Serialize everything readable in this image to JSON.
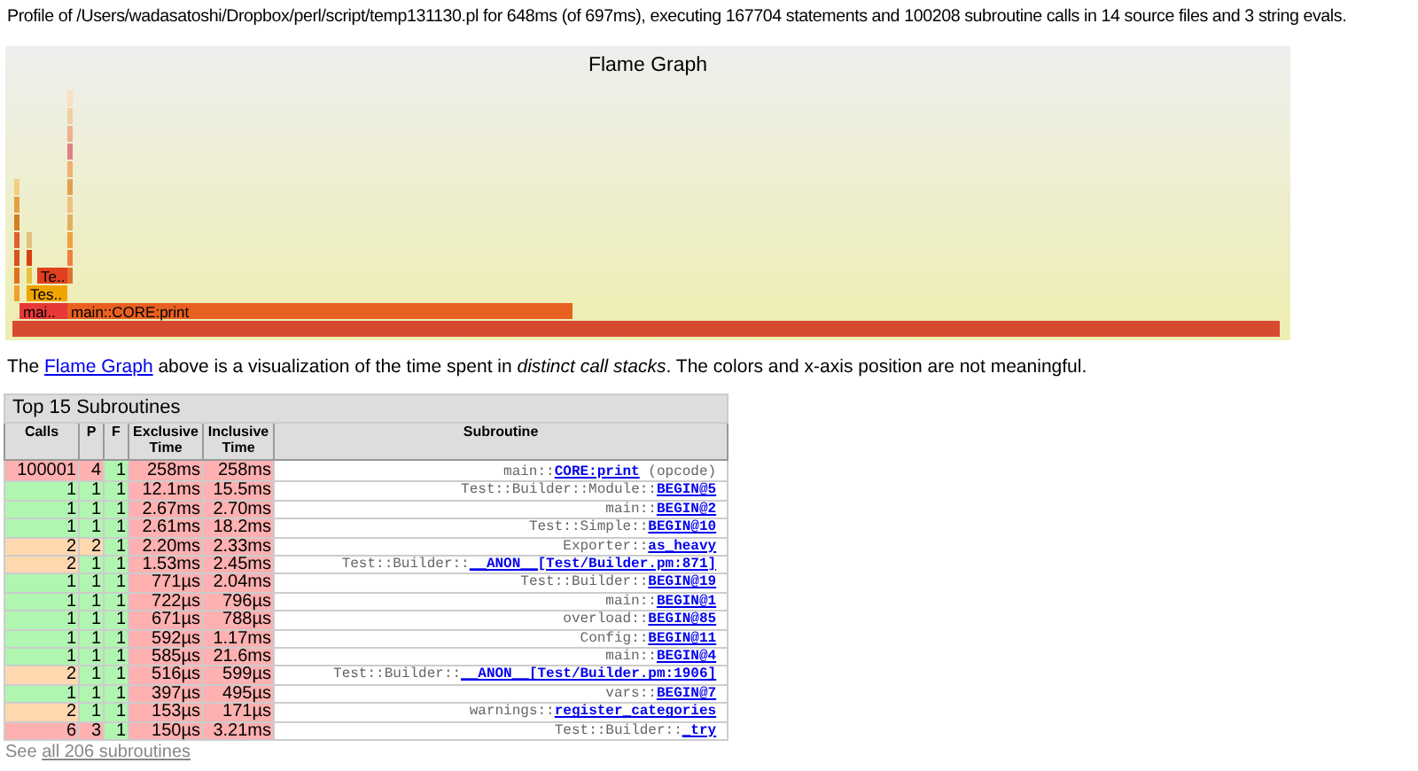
{
  "summary": "Profile of /Users/wadasatoshi/Dropbox/perl/script/temp131130.pl for 648ms (of 697ms), executing 167704 statements and 100208 subroutine calls in 14 source files and 3 string evals.",
  "flame_graph": {
    "title": "Flame Graph",
    "frames": [
      {
        "label": "Te.."
      },
      {
        "label": "Tes.."
      },
      {
        "label": "mai.."
      },
      {
        "label": "main::CORE:print"
      }
    ]
  },
  "description": {
    "before": "The ",
    "link": "Flame Graph",
    "after": " above is a visualization of the time spent in *distinct call stacks*. The colors and x-axis position are not meaningful."
  },
  "table": {
    "title": "Top 15 Subroutines",
    "columns": [
      "Calls",
      "P",
      "F",
      "Exclusive Time",
      "Inclusive Time",
      "Subroutine"
    ],
    "rows": [
      {
        "calls": {
          "text": "100001",
          "color": "#ffb0b0"
        },
        "p": {
          "text": "4",
          "color": "#ffb0b0"
        },
        "f": {
          "text": "1",
          "color": "#b0f5b0"
        },
        "exclusive": "258ms",
        "inclusive": "258ms",
        "package": "main::",
        "name": "CORE:print",
        "suffix": " (opcode)"
      },
      {
        "calls": {
          "text": "1",
          "color": "#b0f5b0"
        },
        "p": {
          "text": "1",
          "color": "#b0f5b0"
        },
        "f": {
          "text": "1",
          "color": "#b0f5b0"
        },
        "exclusive": "12.1ms",
        "inclusive": "15.5ms",
        "package": "Test::Builder::Module::",
        "name": "BEGIN@5"
      },
      {
        "calls": {
          "text": "1",
          "color": "#b0f5b0"
        },
        "p": {
          "text": "1",
          "color": "#b0f5b0"
        },
        "f": {
          "text": "1",
          "color": "#b0f5b0"
        },
        "exclusive": "2.67ms",
        "inclusive": "2.70ms",
        "package": "main::",
        "name": "BEGIN@2"
      },
      {
        "calls": {
          "text": "1",
          "color": "#b0f5b0"
        },
        "p": {
          "text": "1",
          "color": "#b0f5b0"
        },
        "f": {
          "text": "1",
          "color": "#b0f5b0"
        },
        "exclusive": "2.61ms",
        "inclusive": "18.2ms",
        "package": "Test::Simple::",
        "name": "BEGIN@10"
      },
      {
        "calls": {
          "text": "2",
          "color": "#ffd8b0"
        },
        "p": {
          "text": "2",
          "color": "#ffd8b0"
        },
        "f": {
          "text": "1",
          "color": "#b0f5b0"
        },
        "exclusive": "2.20ms",
        "inclusive": "2.33ms",
        "package": "Exporter::",
        "name": "as_heavy"
      },
      {
        "calls": {
          "text": "2",
          "color": "#ffd8b0"
        },
        "p": {
          "text": "1",
          "color": "#b0f5b0"
        },
        "f": {
          "text": "1",
          "color": "#b0f5b0"
        },
        "exclusive": "1.53ms",
        "inclusive": "2.45ms",
        "package": "Test::Builder::",
        "name": "__ANON__[Test/Builder.pm:871]"
      },
      {
        "calls": {
          "text": "1",
          "color": "#b0f5b0"
        },
        "p": {
          "text": "1",
          "color": "#b0f5b0"
        },
        "f": {
          "text": "1",
          "color": "#b0f5b0"
        },
        "exclusive": "771µs",
        "inclusive": "2.04ms",
        "package": "Test::Builder::",
        "name": "BEGIN@19"
      },
      {
        "calls": {
          "text": "1",
          "color": "#b0f5b0"
        },
        "p": {
          "text": "1",
          "color": "#b0f5b0"
        },
        "f": {
          "text": "1",
          "color": "#b0f5b0"
        },
        "exclusive": "722µs",
        "inclusive": "796µs",
        "package": "main::",
        "name": "BEGIN@1"
      },
      {
        "calls": {
          "text": "1",
          "color": "#b0f5b0"
        },
        "p": {
          "text": "1",
          "color": "#b0f5b0"
        },
        "f": {
          "text": "1",
          "color": "#b0f5b0"
        },
        "exclusive": "671µs",
        "inclusive": "788µs",
        "package": "overload::",
        "name": "BEGIN@85"
      },
      {
        "calls": {
          "text": "1",
          "color": "#b0f5b0"
        },
        "p": {
          "text": "1",
          "color": "#b0f5b0"
        },
        "f": {
          "text": "1",
          "color": "#b0f5b0"
        },
        "exclusive": "592µs",
        "inclusive": "1.17ms",
        "package": "Config::",
        "name": "BEGIN@11"
      },
      {
        "calls": {
          "text": "1",
          "color": "#b0f5b0"
        },
        "p": {
          "text": "1",
          "color": "#b0f5b0"
        },
        "f": {
          "text": "1",
          "color": "#b0f5b0"
        },
        "exclusive": "585µs",
        "inclusive": "21.6ms",
        "package": "main::",
        "name": "BEGIN@4"
      },
      {
        "calls": {
          "text": "2",
          "color": "#ffd8b0"
        },
        "p": {
          "text": "1",
          "color": "#b0f5b0"
        },
        "f": {
          "text": "1",
          "color": "#b0f5b0"
        },
        "exclusive": "516µs",
        "inclusive": "599µs",
        "package": "Test::Builder::",
        "name": "__ANON__[Test/Builder.pm:1906]"
      },
      {
        "calls": {
          "text": "1",
          "color": "#b0f5b0"
        },
        "p": {
          "text": "1",
          "color": "#b0f5b0"
        },
        "f": {
          "text": "1",
          "color": "#b0f5b0"
        },
        "exclusive": "397µs",
        "inclusive": "495µs",
        "package": "vars::",
        "name": "BEGIN@7"
      },
      {
        "calls": {
          "text": "2",
          "color": "#ffd8b0"
        },
        "p": {
          "text": "1",
          "color": "#b0f5b0"
        },
        "f": {
          "text": "1",
          "color": "#b0f5b0"
        },
        "exclusive": "153µs",
        "inclusive": "171µs",
        "package": "warnings::",
        "name": "register_categories"
      },
      {
        "calls": {
          "text": "6",
          "color": "#ffb0b0"
        },
        "p": {
          "text": "3",
          "color": "#ffb0b0"
        },
        "f": {
          "text": "1",
          "color": "#b0f5b0"
        },
        "exclusive": "150µs",
        "inclusive": "3.21ms",
        "package": "Test::Builder::",
        "name": "_try"
      }
    ]
  },
  "footer": {
    "before": "See ",
    "link": "all 206 subroutines"
  }
}
